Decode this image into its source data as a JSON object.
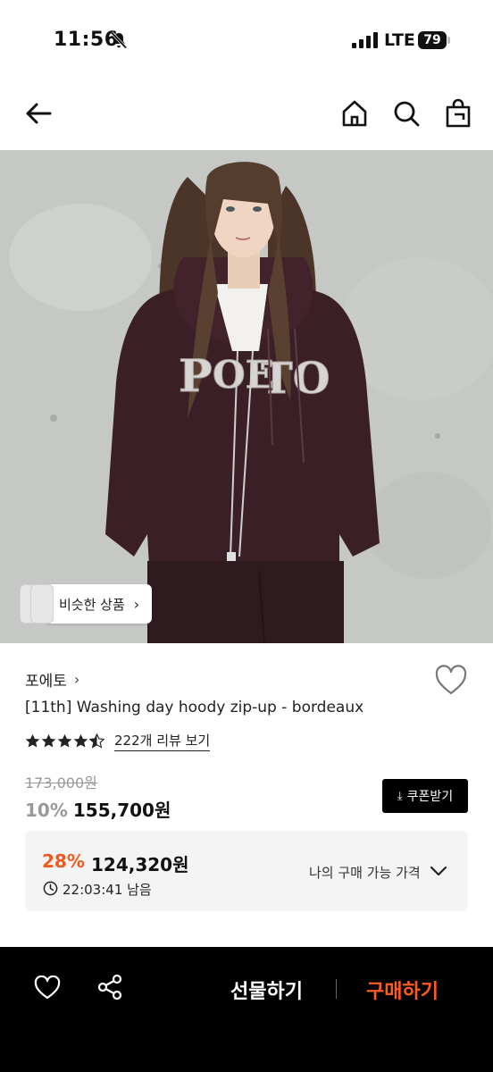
{
  "status_bar": {
    "time": "11:56",
    "network": "LTE",
    "battery": "79"
  },
  "nav": {
    "back_icon": "arrow-left-icon",
    "home_icon": "home-icon",
    "search_icon": "search-icon",
    "cart_icon": "shopping-bag-icon"
  },
  "hero": {
    "similar_label": "비슷한 상품"
  },
  "product": {
    "brand": "포에토",
    "title": "[11th] Washing day hoody zip-up - bordeaux",
    "rating": 4.5,
    "review_link": "222개 리뷰 보기",
    "original_price": "173,000원",
    "discount": "10%",
    "sale_price": "155,700원",
    "coupon_label": "쿠폰받기"
  },
  "my_price": {
    "discount": "28%",
    "price": "124,320원",
    "timer": "22:03:41 남음",
    "label": "나의 구매 가능 가격"
  },
  "bottom_bar": {
    "gift_label": "선물하기",
    "buy_label": "구매하기"
  },
  "colors": {
    "accent_orange": "#ff5a1f",
    "discount_orange": "#ee5a1f",
    "bottom_bar": "#000000"
  }
}
